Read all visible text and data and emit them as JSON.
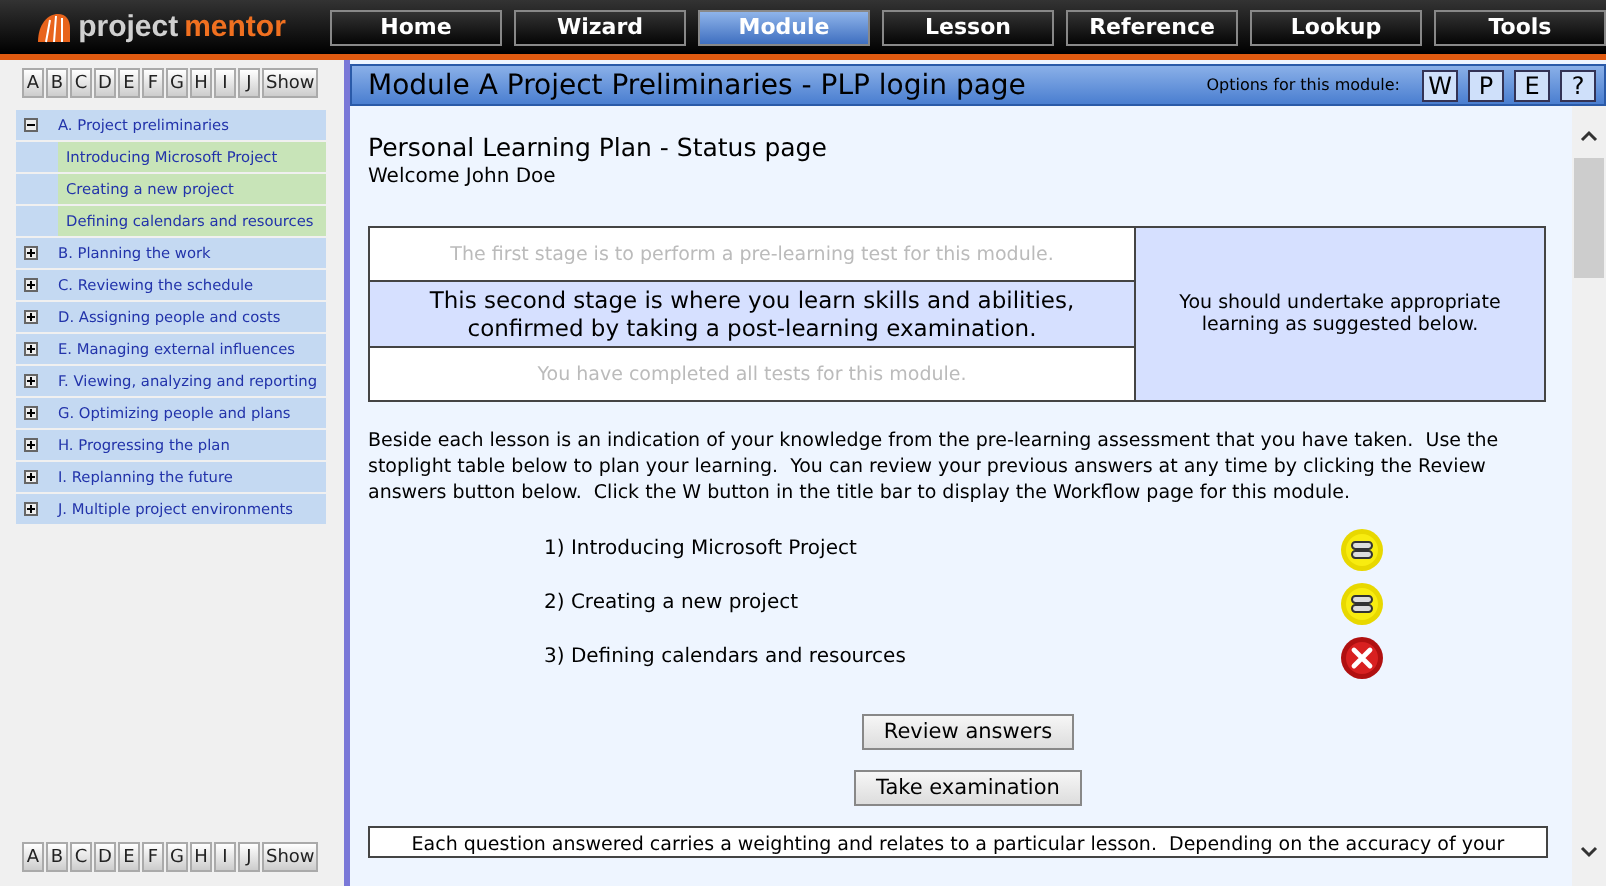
{
  "logo": {
    "word_1": "project",
    "word_2": "mentor"
  },
  "nav": [
    {
      "label": "Home",
      "selected": false
    },
    {
      "label": "Wizard",
      "selected": false
    },
    {
      "label": "Module",
      "selected": true
    },
    {
      "label": "Lesson",
      "selected": false
    },
    {
      "label": "Reference",
      "selected": false
    },
    {
      "label": "Lookup",
      "selected": false
    },
    {
      "label": "Tools",
      "selected": false
    }
  ],
  "sidebar": {
    "letters_top": [
      "A",
      "B",
      "C",
      "D",
      "E",
      "F",
      "G",
      "H",
      "I",
      "J",
      "Show"
    ],
    "items": [
      {
        "label": "A. Project preliminaries",
        "expanded": true,
        "children": [
          {
            "label": "Introducing Microsoft Project"
          },
          {
            "label": "Creating a new project"
          },
          {
            "label": "Defining calendars and resources"
          }
        ]
      },
      {
        "label": "B. Planning the work",
        "expanded": false
      },
      {
        "label": "C. Reviewing the schedule",
        "expanded": false
      },
      {
        "label": "D. Assigning people and costs",
        "expanded": false
      },
      {
        "label": "E. Managing external influences",
        "expanded": false
      },
      {
        "label": "F. Viewing, analyzing and reporting",
        "expanded": false
      },
      {
        "label": "G. Optimizing people and plans",
        "expanded": false
      },
      {
        "label": "H. Progressing the plan",
        "expanded": false
      },
      {
        "label": "I. Replanning the future",
        "expanded": false
      },
      {
        "label": "J. Multiple project environments",
        "expanded": false
      }
    ],
    "letters_bottom": [
      "A",
      "B",
      "C",
      "D",
      "E",
      "F",
      "G",
      "H",
      "I",
      "J",
      "Show"
    ]
  },
  "title_bar": {
    "title": "Module A Project Preliminaries - PLP login page",
    "options_label": "Options for this module:",
    "options": [
      "W",
      "P",
      "E",
      "?"
    ]
  },
  "content": {
    "heading": "Personal Learning Plan - Status page",
    "welcome": "Welcome John Doe",
    "stages": [
      {
        "text": "The first stage is to perform a pre-learning test for this module.",
        "selected": false
      },
      {
        "text": "This second stage is where you learn skills and abilities, confirmed by taking a post-learning examination.",
        "selected": true
      },
      {
        "text": "You have completed all tests for this module.",
        "selected": false
      }
    ],
    "stage_advice": "You should undertake appropriate learning as suggested below.",
    "intro": "Beside each lesson is an indication of your knowledge from the pre-learning assessment that you have taken.  Use the stoplight table below to plan your learning.  You can review your previous answers at any time by clicking the Review answers button below.  Click the W button in the title bar to display the Workflow page for this module.",
    "lessons": [
      {
        "label": "1) Introducing Microsoft Project",
        "kind": "caution"
      },
      {
        "label": "2) Creating a new project",
        "kind": "caution"
      },
      {
        "label": "3) Defining calendars and resources",
        "kind": "cross"
      }
    ],
    "buttons": [
      "Review answers",
      "Take examination"
    ],
    "note": "Each question answered carries a weighting and relates to a particular lesson.  Depending on the accuracy of your"
  }
}
